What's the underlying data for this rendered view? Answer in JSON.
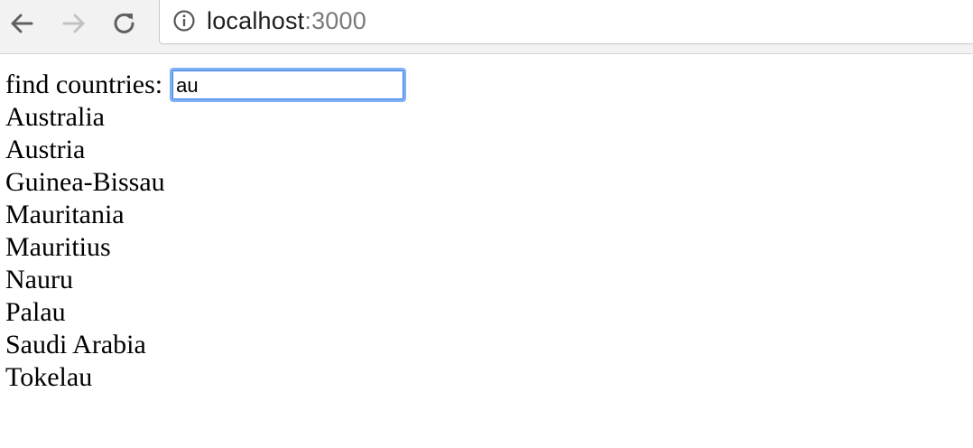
{
  "browser": {
    "url_host": "localhost",
    "url_port": ":3000"
  },
  "page": {
    "search_label": "find countries:",
    "search_value": "au",
    "countries": [
      "Australia",
      "Austria",
      "Guinea-Bissau",
      "Mauritania",
      "Mauritius",
      "Nauru",
      "Palau",
      "Saudi Arabia",
      "Tokelau"
    ]
  }
}
